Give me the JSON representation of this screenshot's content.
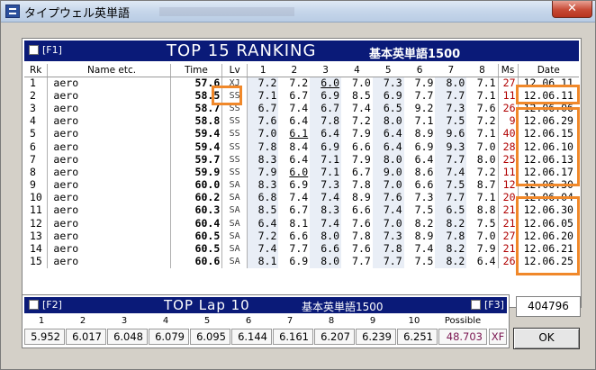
{
  "window": {
    "title": "タイプウェル英単語",
    "close_label": "✕"
  },
  "ranking": {
    "fkey": "[F1]",
    "title": "TOP 15   RANKING",
    "subtitle": "基本英単語1500",
    "columns": [
      "Rk",
      "Name etc.",
      "Time",
      "Lv",
      "1",
      "2",
      "3",
      "4",
      "5",
      "6",
      "7",
      "8",
      "Ms",
      "Date"
    ],
    "rows": [
      {
        "rk": "1",
        "name": "aero",
        "time": "57.6",
        "lv": "XJ",
        "laps": [
          "7.2",
          "7.2",
          "6.0",
          "7.0",
          "7.3",
          "7.9",
          "8.0",
          "7.1"
        ],
        "ms": "27",
        "date": "12.06.11"
      },
      {
        "rk": "2",
        "name": "aero",
        "time": "58.5",
        "lv": "SS",
        "laps": [
          "7.1",
          "6.7",
          "6.9",
          "8.5",
          "6.9",
          "7.7",
          "7.7",
          "7.1"
        ],
        "ms": "11",
        "date": "12.06.11"
      },
      {
        "rk": "3",
        "name": "aero",
        "time": "58.7",
        "lv": "SS",
        "laps": [
          "6.7",
          "7.4",
          "6.7",
          "7.4",
          "6.5",
          "9.2",
          "7.3",
          "7.6"
        ],
        "ms": "26",
        "date": "12.06.06"
      },
      {
        "rk": "4",
        "name": "aero",
        "time": "58.8",
        "lv": "SS",
        "laps": [
          "7.6",
          "6.4",
          "7.8",
          "7.2",
          "8.0",
          "7.1",
          "7.5",
          "7.2"
        ],
        "ms": "9",
        "date": "12.06.29"
      },
      {
        "rk": "5",
        "name": "aero",
        "time": "59.4",
        "lv": "SS",
        "laps": [
          "7.0",
          "6.1",
          "6.4",
          "7.9",
          "6.4",
          "8.9",
          "9.6",
          "7.1"
        ],
        "ms": "40",
        "date": "12.06.15"
      },
      {
        "rk": "6",
        "name": "aero",
        "time": "59.4",
        "lv": "SS",
        "laps": [
          "7.8",
          "8.4",
          "6.9",
          "6.6",
          "6.4",
          "6.9",
          "9.3",
          "7.0"
        ],
        "ms": "28",
        "date": "12.06.10"
      },
      {
        "rk": "7",
        "name": "aero",
        "time": "59.7",
        "lv": "SS",
        "laps": [
          "8.3",
          "6.4",
          "7.1",
          "7.9",
          "8.0",
          "6.4",
          "7.7",
          "8.0"
        ],
        "ms": "25",
        "date": "12.06.13"
      },
      {
        "rk": "8",
        "name": "aero",
        "time": "59.9",
        "lv": "SS",
        "laps": [
          "7.9",
          "6.0",
          "7.1",
          "6.7",
          "9.0",
          "8.6",
          "7.4",
          "7.2"
        ],
        "ms": "11",
        "date": "12.06.17"
      },
      {
        "rk": "9",
        "name": "aero",
        "time": "60.0",
        "lv": "SA",
        "laps": [
          "8.3",
          "6.9",
          "7.3",
          "7.8",
          "7.0",
          "6.6",
          "7.5",
          "8.7"
        ],
        "ms": "12",
        "date": "12.06.30"
      },
      {
        "rk": "10",
        "name": "aero",
        "time": "60.2",
        "lv": "SA",
        "laps": [
          "6.8",
          "7.4",
          "7.4",
          "8.9",
          "7.6",
          "7.3",
          "7.7",
          "7.1"
        ],
        "ms": "20",
        "date": "12.06.04"
      },
      {
        "rk": "11",
        "name": "aero",
        "time": "60.3",
        "lv": "SA",
        "laps": [
          "8.5",
          "6.7",
          "8.3",
          "6.6",
          "7.4",
          "7.5",
          "6.5",
          "8.8"
        ],
        "ms": "21",
        "date": "12.06.30"
      },
      {
        "rk": "12",
        "name": "aero",
        "time": "60.4",
        "lv": "SA",
        "laps": [
          "6.4",
          "8.1",
          "7.4",
          "7.6",
          "7.0",
          "8.2",
          "8.2",
          "7.5"
        ],
        "ms": "21",
        "date": "12.06.05"
      },
      {
        "rk": "13",
        "name": "aero",
        "time": "60.5",
        "lv": "SA",
        "laps": [
          "7.2",
          "6.6",
          "8.0",
          "7.8",
          "7.3",
          "8.9",
          "7.8",
          "7.0"
        ],
        "ms": "27",
        "date": "12.06.20"
      },
      {
        "rk": "14",
        "name": "aero",
        "time": "60.5",
        "lv": "SA",
        "laps": [
          "7.4",
          "7.7",
          "6.6",
          "7.6",
          "7.8",
          "7.4",
          "8.2",
          "7.9"
        ],
        "ms": "21",
        "date": "12.06.21"
      },
      {
        "rk": "15",
        "name": "aero",
        "time": "60.6",
        "lv": "SA",
        "laps": [
          "8.1",
          "6.9",
          "8.0",
          "7.7",
          "7.7",
          "7.5",
          "8.2",
          "6.4"
        ],
        "ms": "26",
        "date": "12.06.25"
      }
    ]
  },
  "toplap": {
    "fkey_left": "[F2]",
    "fkey_right": "[F3]",
    "title": "TOP Lap 10",
    "subtitle": "基本英単語1500",
    "labels": [
      "1",
      "2",
      "3",
      "4",
      "5",
      "6",
      "7",
      "8",
      "9",
      "10",
      "Possible"
    ],
    "values": [
      "5.952",
      "6.017",
      "6.048",
      "6.079",
      "6.095",
      "6.144",
      "6.161",
      "6.207",
      "6.239",
      "6.251",
      "48.703"
    ],
    "possible_level": "XF"
  },
  "score": "404796",
  "ok_label": "OK",
  "colors": {
    "header_bg": "#0a1a78",
    "highlight": "#f0882a",
    "miss": "#b00000"
  }
}
